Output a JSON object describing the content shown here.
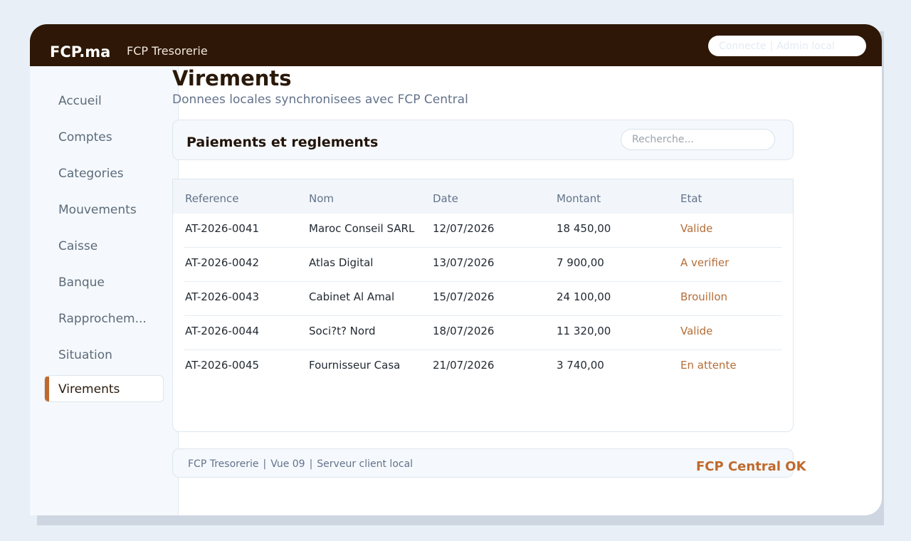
{
  "header": {
    "brand": "FCP.ma",
    "app_title": "FCP Tresorerie",
    "status_connected": "Connecte",
    "status_separator": "|",
    "status_user": "Admin local"
  },
  "sidebar": {
    "items": [
      {
        "label": "Accueil"
      },
      {
        "label": "Comptes"
      },
      {
        "label": "Categories"
      },
      {
        "label": "Mouvements"
      },
      {
        "label": "Caisse"
      },
      {
        "label": "Banque"
      },
      {
        "label": "Rapprochem..."
      },
      {
        "label": "Situation"
      },
      {
        "label": "Virements"
      }
    ],
    "active_index": 8
  },
  "main": {
    "title": "Virements",
    "subtitle": "Donnees locales synchronisees avec FCP Central",
    "panel_title": "Paiements et reglements",
    "search_placeholder": "Recherche..."
  },
  "table": {
    "headers": [
      "Reference",
      "Nom",
      "Date",
      "Montant",
      "Etat"
    ],
    "rows": [
      [
        "AT-2026-0041",
        "Maroc Conseil SARL",
        "12/07/2026",
        "18 450,00",
        "Valide"
      ],
      [
        "AT-2026-0042",
        "Atlas Digital",
        "13/07/2026",
        "7 900,00",
        "A verifier"
      ],
      [
        "AT-2026-0043",
        "Cabinet Al Amal",
        "15/07/2026",
        "24 100,00",
        "Brouillon"
      ],
      [
        "AT-2026-0044",
        "Soci?t? Nord",
        "18/07/2026",
        "11 320,00",
        "Valide"
      ],
      [
        "AT-2026-0045",
        "Fournisseur Casa",
        "21/07/2026",
        "3 740,00",
        "En attente"
      ]
    ]
  },
  "footer": {
    "app": "FCP Tresorerie",
    "separator": "|",
    "view": "Vue 09",
    "server": "Serveur client local",
    "central_status": "FCP Central OK"
  },
  "colors": {
    "topbar": "#2e1706",
    "accent": "#c0682c",
    "status_text": "#b56d37",
    "sidebar_bg": "#f5f9fd"
  }
}
